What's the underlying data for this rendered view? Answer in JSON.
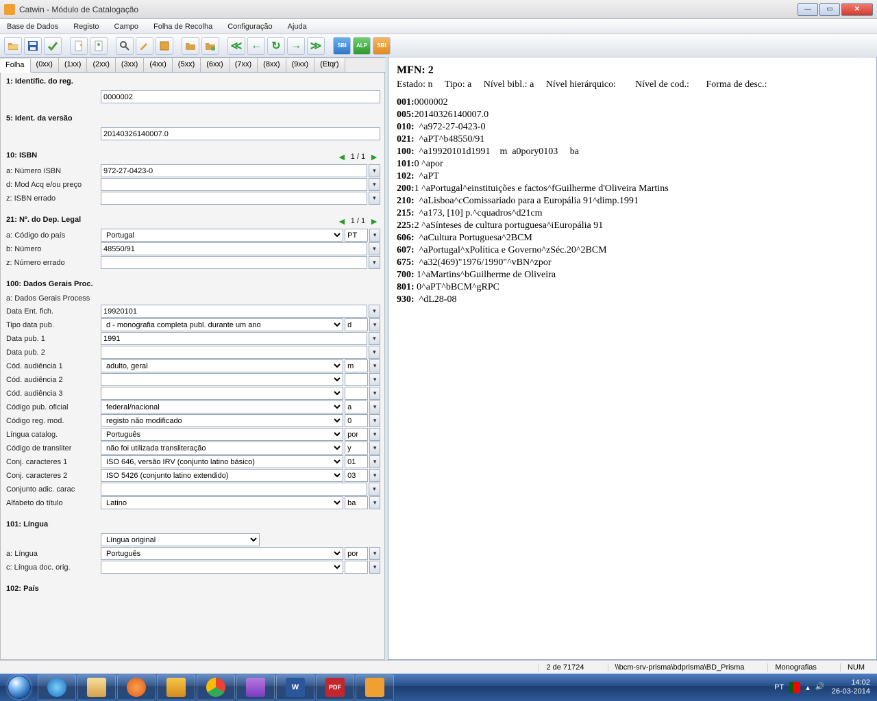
{
  "window": {
    "title": "Catwin - Módulo de Catalogação"
  },
  "menu": [
    "Base de Dados",
    "Registo",
    "Campo",
    "Folha de Recolha",
    "Configuração",
    "Ajuda"
  ],
  "tabs": [
    "Folha",
    "(0xx)",
    "(1xx)",
    "(2xx)",
    "(3xx)",
    "(4xx)",
    "(5xx)",
    "(6xx)",
    "(7xx)",
    "(8xx)",
    "(9xx)",
    "(Etqr)"
  ],
  "sec1": {
    "title": "1: Identific. do reg.",
    "value": "0000002"
  },
  "sec5": {
    "title": "5: Ident. da versão",
    "value": "20140326140007.0"
  },
  "sec10": {
    "title": "10: ISBN",
    "pager": "1 / 1",
    "rows": [
      {
        "lbl": "a: Número ISBN",
        "val": "972-27-0423-0"
      },
      {
        "lbl": "d: Mod Acq e/ou preço",
        "val": ""
      },
      {
        "lbl": "z: ISBN errado",
        "val": ""
      }
    ]
  },
  "sec21": {
    "title": "21: Nº. do Dep. Legal",
    "pager": "1 / 1",
    "rows": [
      {
        "lbl": "a: Código do país",
        "sel": "Portugal",
        "mini": "PT"
      },
      {
        "lbl": "b: Número",
        "val": "48550/91"
      },
      {
        "lbl": "z: Número errado",
        "val": ""
      }
    ]
  },
  "sec100": {
    "title": "100: Dados Gerais Proc.",
    "subtitle": "a: Dados Gerais Process",
    "rows": [
      {
        "lbl": "Data Ent. fich.",
        "val": "19920101"
      },
      {
        "lbl": "Tipo data pub.",
        "sel": "d - monografia completa publ. durante um ano",
        "mini": "d"
      },
      {
        "lbl": "Data pub. 1",
        "val": "1991"
      },
      {
        "lbl": "Data pub. 2",
        "val": ""
      },
      {
        "lbl": "Cód. audiência 1",
        "sel": "adulto, geral",
        "mini": "m"
      },
      {
        "lbl": "Cód. audiência 2",
        "sel": "",
        "mini": ""
      },
      {
        "lbl": "Cód. audiência 3",
        "sel": "",
        "mini": ""
      },
      {
        "lbl": "Código pub. oficial",
        "sel": "federal/nacional",
        "mini": "a"
      },
      {
        "lbl": "Código reg. mod.",
        "sel": "registo não modificado",
        "mini": "0"
      },
      {
        "lbl": "Língua catalog.",
        "sel": "Português",
        "mini": "por"
      },
      {
        "lbl": "Código de transliter",
        "sel": "não foi utilizada transliteração",
        "mini": "y"
      },
      {
        "lbl": "Conj. caracteres 1",
        "sel": "ISO 646, versão IRV (conjunto latino básico)",
        "mini": "01"
      },
      {
        "lbl": "Conj. caracteres 2",
        "sel": "ISO 5426 (conjunto latino extendido)",
        "mini": "03"
      },
      {
        "lbl": "Conjunto adic. carac",
        "val": ""
      },
      {
        "lbl": "Alfabeto do título",
        "sel": "Latino",
        "mini": "ba"
      }
    ]
  },
  "sec101": {
    "title": "101: Língua",
    "topsel": "Língua original",
    "rows": [
      {
        "lbl": "a: Língua",
        "sel": "Português",
        "mini": "por"
      },
      {
        "lbl": "c: Língua doc. orig.",
        "sel": "",
        "mini": ""
      }
    ]
  },
  "sec102": {
    "title": "102: País"
  },
  "record": {
    "mfn": "MFN: 2",
    "status": "Estado: n     Tipo: a     Nível bibl.: a     Nível hierárquico:        Nível de cod.:       Forma de desc.:",
    "lines": [
      {
        "tag": "001:",
        "txt": "0000002"
      },
      {
        "tag": "005:",
        "txt": "20140326140007.0"
      },
      {
        "tag": "010:",
        "txt": "  ^a972-27-0423-0"
      },
      {
        "tag": "021:",
        "txt": "  ^aPT^b48550/91"
      },
      {
        "tag": "100:",
        "txt": "  ^a19920101d1991    m  a0pory0103     ba"
      },
      {
        "tag": "101:",
        "txt": "0 ^apor"
      },
      {
        "tag": "102:",
        "txt": "  ^aPT"
      },
      {
        "tag": "200:",
        "txt": "1 ^aPortugal^einstituições e factos^fGuilherme d'Oliveira Martins"
      },
      {
        "tag": "210:",
        "txt": "  ^aLisboa^cComissariado para a Europália 91^dimp.1991"
      },
      {
        "tag": "215:",
        "txt": "  ^a173, [10] p.^cquadros^d21cm"
      },
      {
        "tag": "225:",
        "txt": "2 ^aSínteses de cultura portuguesa^iEuropália 91"
      },
      {
        "tag": "606:",
        "txt": "  ^aCultura Portuguesa^2BCM"
      },
      {
        "tag": "607:",
        "txt": "  ^aPortugal^xPolítica e Governo^zSéc.20^2BCM"
      },
      {
        "tag": "675:",
        "txt": "  ^a32(469)\"1976/1990\"^vBN^zpor"
      },
      {
        "tag": "700:",
        "txt": " 1^aMartins^bGuilherme de Oliveira"
      },
      {
        "tag": "801:",
        "txt": " 0^aPT^bBCM^gRPC"
      },
      {
        "tag": "930:",
        "txt": "  ^dL28-08"
      }
    ]
  },
  "footer": {
    "pos": "2 de 71724",
    "path": "\\\\bcm-srv-prisma\\bdprisma\\BD_Prisma",
    "mode": "Monografias",
    "kb": "NUM"
  },
  "tray": {
    "lang": "PT",
    "time": "14:02",
    "date": "26-03-2014"
  }
}
